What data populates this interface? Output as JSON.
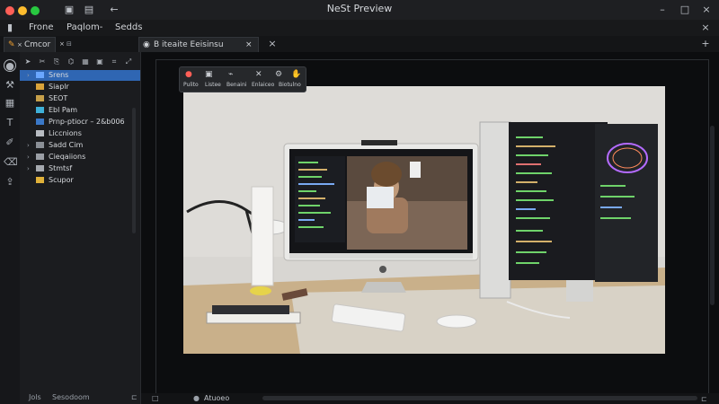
{
  "window": {
    "title": "NeSt Preview"
  },
  "menu": [
    "Frone",
    "Paqlom-",
    "Sedds"
  ],
  "tabs": [
    {
      "label": "Cmcor"
    },
    {
      "label": "B iteaite Eeisinsu"
    }
  ],
  "sidebar": {
    "items": [
      {
        "label": "Srens",
        "kind": "file",
        "selected": true
      },
      {
        "label": "Siaplr",
        "kind": "file"
      },
      {
        "label": "SEOT",
        "kind": "file"
      },
      {
        "label": "Ebl Pam",
        "kind": "file"
      },
      {
        "label": "Prnp-ptiocr – 2&b006",
        "kind": "file"
      },
      {
        "label": "Liccnions",
        "kind": "file"
      },
      {
        "label": "Sadd Cim",
        "kind": "folder"
      },
      {
        "label": "Cieqaiions",
        "kind": "folder"
      },
      {
        "label": "Stmtsf",
        "kind": "folder"
      },
      {
        "label": "Scupor",
        "kind": "folder"
      }
    ],
    "footer": [
      "Jols",
      "Sesodoom"
    ]
  },
  "popup": {
    "labels": [
      "Pulito",
      "Listee",
      "Benaini",
      "Enlaiceo",
      "Biotulno"
    ]
  },
  "canvas": {
    "status_label": "Atuoeo"
  },
  "colors": {
    "accent": "#2f66b3",
    "bg": "#0f1012"
  }
}
